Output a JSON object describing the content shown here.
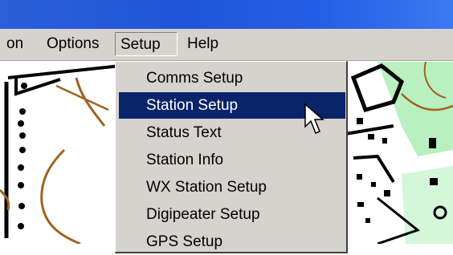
{
  "menubar": {
    "items": [
      {
        "label": "on"
      },
      {
        "label": "Options"
      },
      {
        "label": "Setup"
      },
      {
        "label": "Help"
      }
    ]
  },
  "setup_menu": {
    "items": [
      {
        "label": "Comms Setup"
      },
      {
        "label": "Station Setup",
        "highlighted": true
      },
      {
        "label": "Status Text"
      },
      {
        "label": "Station Info"
      },
      {
        "label": "WX Station Setup"
      },
      {
        "label": "Digipeater Setup"
      },
      {
        "label": "GPS Setup"
      }
    ]
  },
  "colors": {
    "titlebar": "#1f56d8",
    "menubar": "#d6d3ce",
    "highlight": "#0a246a",
    "map_green": "#b8f0c0",
    "contour": "#a0621e"
  }
}
